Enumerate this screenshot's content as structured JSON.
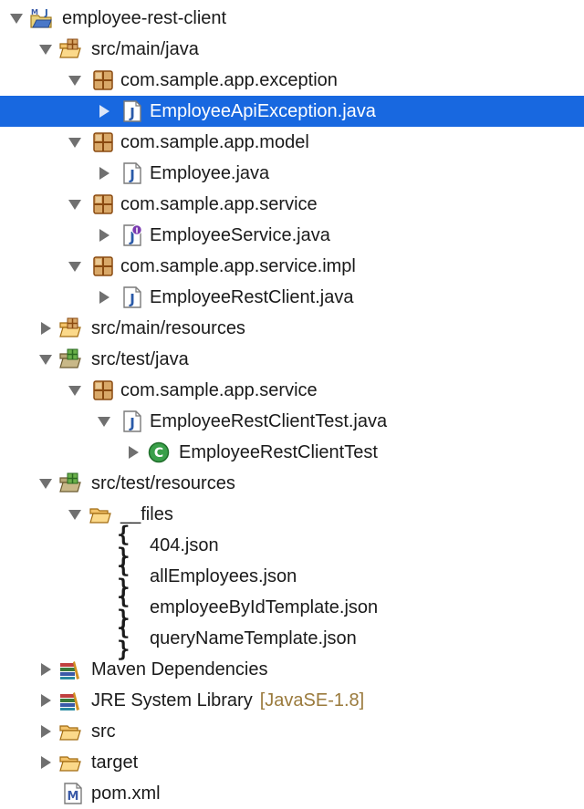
{
  "tree": {
    "project": "employee-rest-client",
    "src_main_java": {
      "label": "src/main/java",
      "pkg_exception": "com.sample.app.exception",
      "file_exception": "EmployeeApiException.java",
      "pkg_model": "com.sample.app.model",
      "file_employee": "Employee.java",
      "pkg_service": "com.sample.app.service",
      "file_service": "EmployeeService.java",
      "pkg_service_impl": "com.sample.app.service.impl",
      "file_rest_client": "EmployeeRestClient.java"
    },
    "src_main_resources": "src/main/resources",
    "src_test_java": {
      "label": "src/test/java",
      "pkg_service": "com.sample.app.service",
      "file_test": "EmployeeRestClientTest.java",
      "class_test": "EmployeeRestClientTest"
    },
    "src_test_resources": {
      "label": "src/test/resources",
      "folder_files": "__files",
      "json_files": [
        "404.json",
        "allEmployees.json",
        "employeeByIdTemplate.json",
        "queryNameTemplate.json"
      ]
    },
    "maven_dependencies": "Maven Dependencies",
    "jre_library": "JRE System Library",
    "jre_decoration": "[JavaSE-1.8]",
    "src": "src",
    "target": "target",
    "pom": "pom.xml"
  },
  "colors": {
    "selection": "#1868e0",
    "decoration": "#9a7a3c"
  }
}
